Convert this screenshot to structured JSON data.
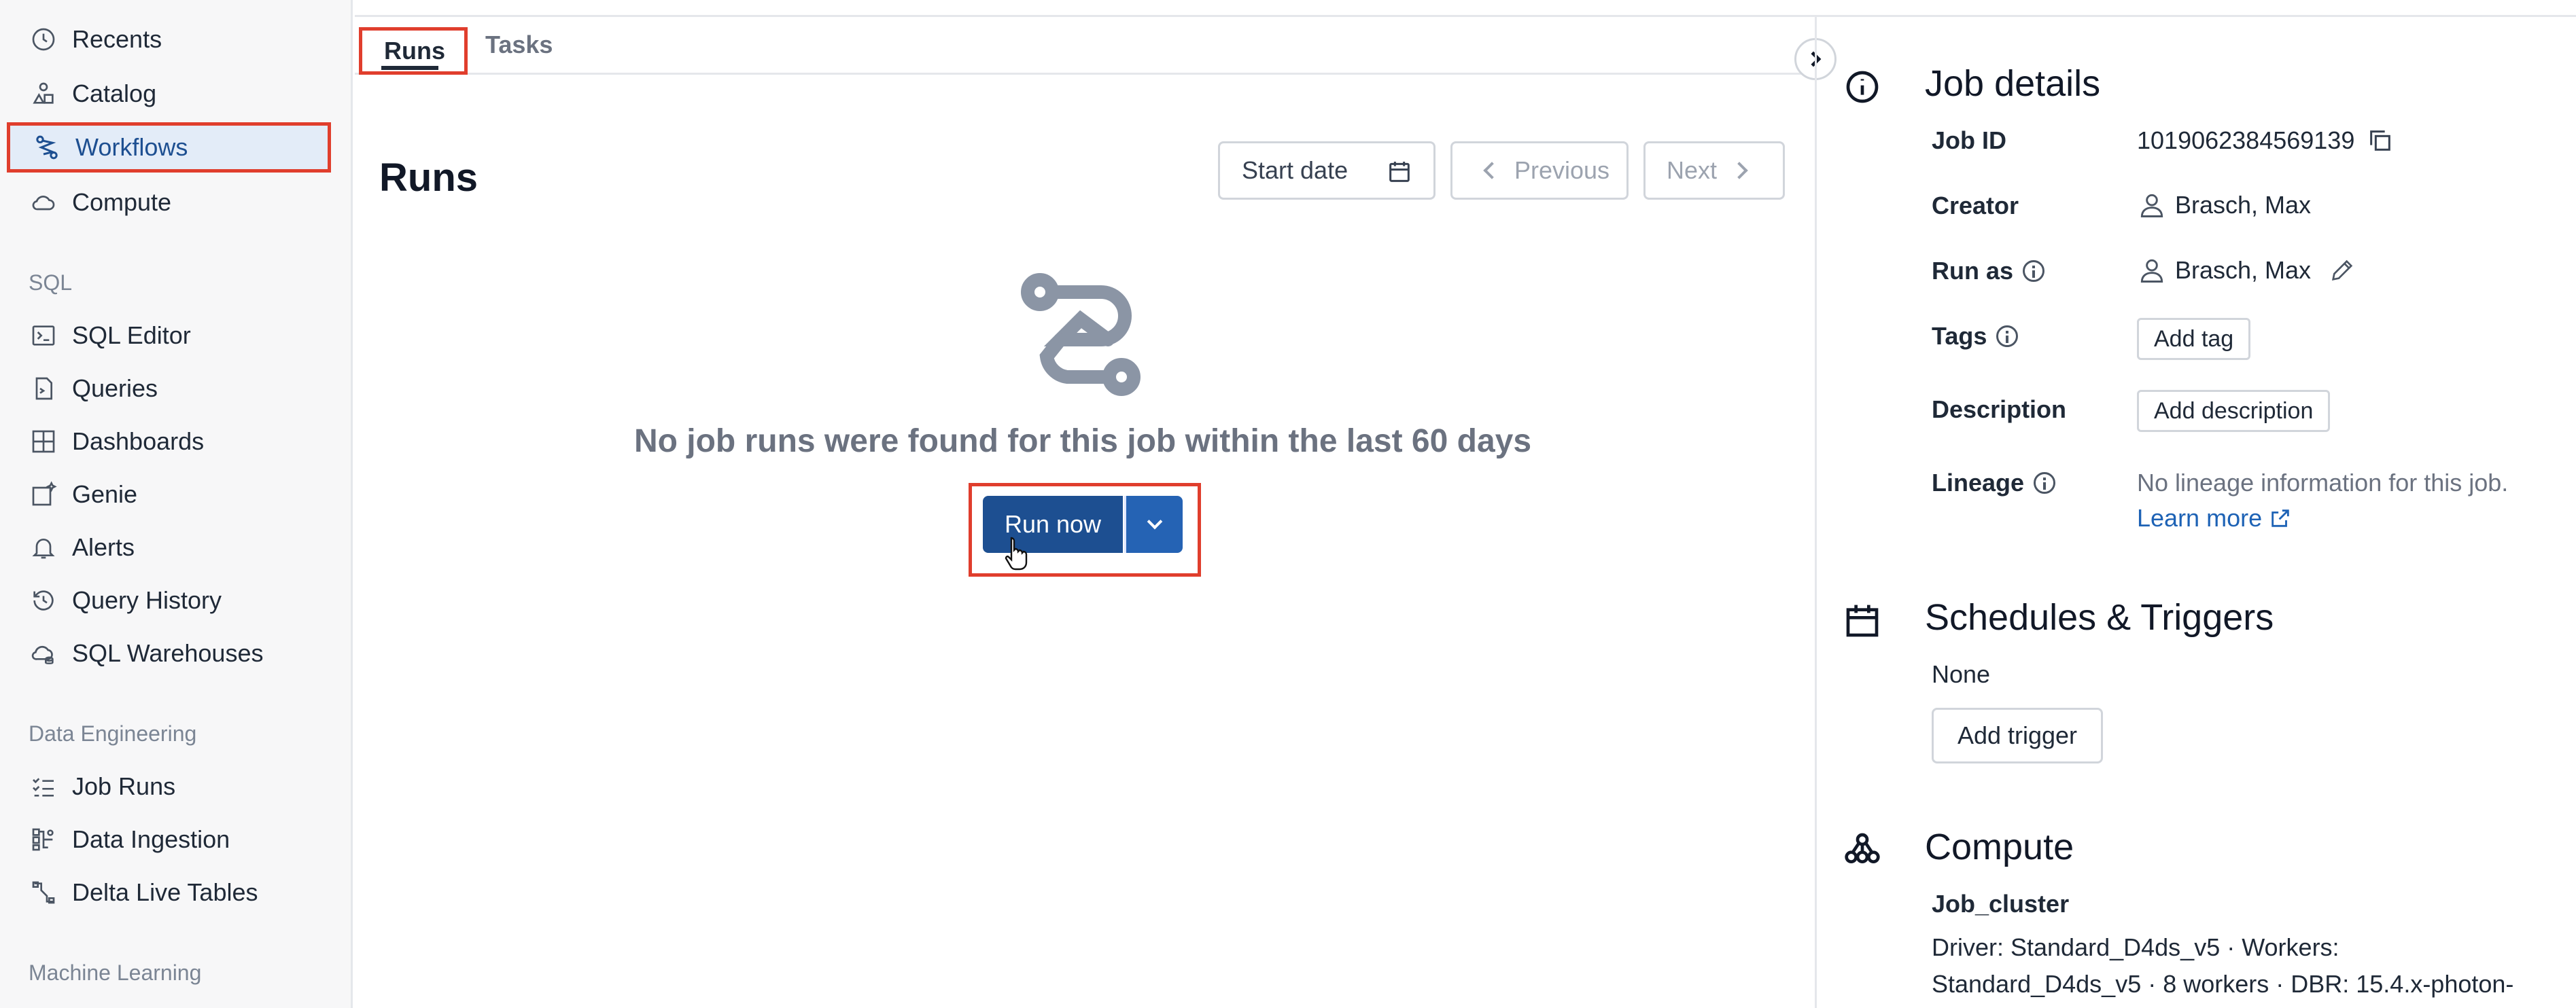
{
  "sidebar": {
    "items": [
      {
        "label": "Recents",
        "icon": "clock-icon"
      },
      {
        "label": "Catalog",
        "icon": "catalog-icon"
      },
      {
        "label": "Workflows",
        "icon": "workflows-icon",
        "active": true
      },
      {
        "label": "Compute",
        "icon": "cloud-icon"
      }
    ],
    "sql_section": "SQL",
    "sql_items": [
      {
        "label": "SQL Editor",
        "icon": "terminal-icon"
      },
      {
        "label": "Queries",
        "icon": "query-icon"
      },
      {
        "label": "Dashboards",
        "icon": "dashboard-icon"
      },
      {
        "label": "Genie",
        "icon": "sparkle-icon"
      },
      {
        "label": "Alerts",
        "icon": "bell-icon"
      },
      {
        "label": "Query History",
        "icon": "history-icon"
      },
      {
        "label": "SQL Warehouses",
        "icon": "warehouse-icon"
      }
    ],
    "de_section": "Data Engineering",
    "de_items": [
      {
        "label": "Job Runs",
        "icon": "list-check-icon"
      },
      {
        "label": "Data Ingestion",
        "icon": "ingestion-icon"
      },
      {
        "label": "Delta Live Tables",
        "icon": "pipeline-icon"
      }
    ],
    "ml_section": "Machine Learning"
  },
  "tabs": {
    "runs": "Runs",
    "tasks": "Tasks"
  },
  "main": {
    "title": "Runs",
    "start_date": "Start date",
    "previous": "Previous",
    "next": "Next",
    "empty_message": "No job runs were found for this job within the last 60 days",
    "run_now": "Run now"
  },
  "details": {
    "title": "Job details",
    "job_id_label": "Job ID",
    "job_id": "1019062384569139",
    "creator_label": "Creator",
    "creator": "Brasch, Max",
    "run_as_label": "Run as",
    "run_as": "Brasch, Max",
    "tags_label": "Tags",
    "add_tag": "Add tag",
    "description_label": "Description",
    "add_description": "Add description",
    "lineage_label": "Lineage",
    "lineage_text": "No lineage information for this job.",
    "learn_more": "Learn more"
  },
  "schedules": {
    "title": "Schedules & Triggers",
    "value": "None",
    "add_trigger": "Add trigger"
  },
  "compute": {
    "title": "Compute",
    "cluster": "Job_cluster",
    "line1": "Driver: Standard_D4ds_v5 · Workers:",
    "line2": "Standard_D4ds_v5 · 8 workers · DBR: 15.4.x-photon-"
  },
  "colors": {
    "accent": "#1d4f91",
    "highlight": "#e03e2d",
    "active_bg": "#e3ecf8"
  }
}
